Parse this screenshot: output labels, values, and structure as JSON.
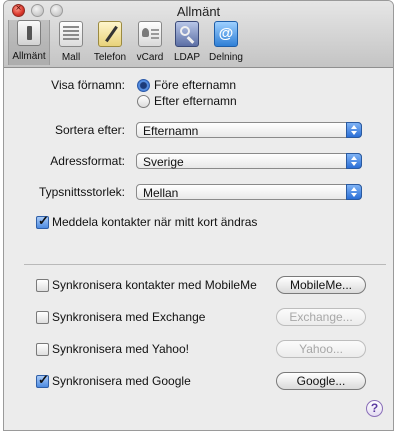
{
  "window": {
    "title": "Allmänt"
  },
  "toolbar": {
    "items": [
      {
        "label": "Allmänt",
        "icon": "general-switch-icon"
      },
      {
        "label": "Mall",
        "icon": "template-icon"
      },
      {
        "label": "Telefon",
        "icon": "phone-pencil-icon"
      },
      {
        "label": "vCard",
        "icon": "vcard-icon"
      },
      {
        "label": "LDAP",
        "icon": "ldap-search-icon"
      },
      {
        "label": "Delning",
        "icon": "at-sign-icon",
        "glyph": "@"
      }
    ]
  },
  "display_name": {
    "label": "Visa förnamn:",
    "options": [
      "Före efternamn",
      "Efter efternamn"
    ],
    "selected": "Före efternamn"
  },
  "sort_by": {
    "label": "Sortera efter:",
    "value": "Efternamn"
  },
  "address_format": {
    "label": "Adressformat:",
    "value": "Sverige"
  },
  "font_size": {
    "label": "Typsnittsstorlek:",
    "value": "Mellan"
  },
  "notify_contacts": {
    "label": "Meddela kontakter när mitt kort ändras",
    "checked": true
  },
  "sync": [
    {
      "label": "Synkronisera kontakter med MobileMe",
      "checked": false,
      "button": "MobileMe...",
      "button_enabled": true
    },
    {
      "label": "Synkronisera med Exchange",
      "checked": false,
      "button": "Exchange...",
      "button_enabled": false
    },
    {
      "label": "Synkronisera med Yahoo!",
      "checked": false,
      "button": "Yahoo...",
      "button_enabled": false
    },
    {
      "label": "Synkronisera med Google",
      "checked": true,
      "button": "Google...",
      "button_enabled": true
    }
  ],
  "help": {
    "glyph": "?"
  },
  "controls": {
    "close_glyph": "×",
    "check_glyph": "✓"
  },
  "colors": {
    "accent": "#2f6cd0",
    "window_bg": "#ececec"
  }
}
